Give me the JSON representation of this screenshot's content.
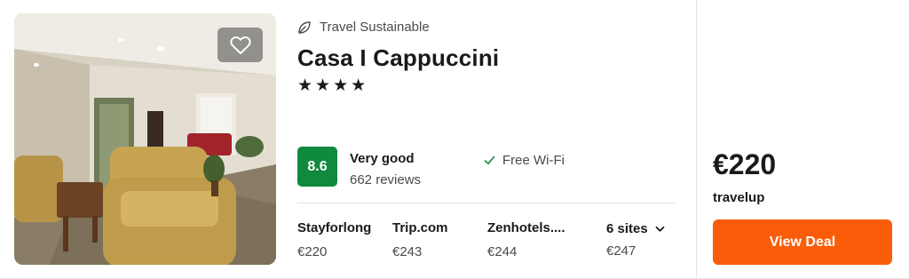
{
  "hotel": {
    "sustainability_label": "Travel Sustainable",
    "name": "Casa I Cappuccini",
    "stars_text": "★★★★",
    "star_count": 4,
    "score": "8.6",
    "rating_label": "Very good",
    "reviews": "662 reviews",
    "amenity": "Free Wi-Fi"
  },
  "sites": [
    {
      "name": "Stayforlong",
      "price": "€220"
    },
    {
      "name": "Trip.com",
      "price": "€243"
    },
    {
      "name": "Zenhotels....",
      "price": "€244"
    }
  ],
  "more_sites": {
    "label": "6 sites",
    "price": "€247"
  },
  "offer": {
    "price": "€220",
    "provider": "travelup",
    "cta": "View Deal"
  },
  "colors": {
    "score_bg": "#108a3e",
    "cta_bg": "#fa5d09",
    "check": "#108a3e"
  },
  "icons": {
    "favorite": "heart-icon",
    "sustainability": "leaf-icon",
    "amenity": "check-icon",
    "expand": "chevron-down-icon"
  }
}
